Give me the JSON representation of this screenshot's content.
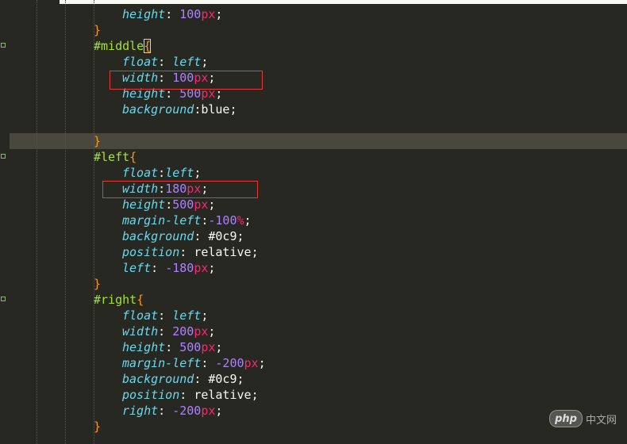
{
  "editor": {
    "theme_colors": {
      "background": "#272822",
      "property": "#66d9ef",
      "number": "#ae81ff",
      "unit": "#f92672",
      "selector": "#a6e22e",
      "brace": "#fd971f",
      "highlight_box": "#e03c3c"
    },
    "lines": [
      {
        "prop": "height",
        "colon": ": ",
        "num": "100",
        "unit": "px",
        "end": ";"
      },
      {
        "brace": "}"
      },
      {
        "selector": "#middle",
        "open": "{"
      },
      {
        "prop": "float",
        "colon": ": ",
        "kw": "left",
        "end": ";"
      },
      {
        "prop": "width",
        "colon": ": ",
        "num": "100",
        "unit": "px",
        "end": ";"
      },
      {
        "prop": "height",
        "colon": ": ",
        "num": "500",
        "unit": "px",
        "end": ";"
      },
      {
        "prop": "background",
        "colon": ":",
        "val": "blue",
        "end": ";"
      },
      {},
      {
        "brace": "}"
      },
      {
        "selector": "#left",
        "open": "{"
      },
      {
        "prop": "float",
        "colon": ":",
        "kw": "left",
        "end": ";"
      },
      {
        "prop": "width",
        "colon": ":",
        "num": "180",
        "unit": "px",
        "end": ";"
      },
      {
        "prop": "height",
        "colon": ":",
        "num": "500",
        "unit": "px",
        "end": ";"
      },
      {
        "prop": "margin-left",
        "colon": ":",
        "num": "-100",
        "unit": "%",
        "end": ";"
      },
      {
        "prop": "background",
        "colon": ": ",
        "val": "#0c9",
        "end": ";"
      },
      {
        "prop": "position",
        "colon": ": ",
        "val": "relative",
        "end": ";"
      },
      {
        "prop": "left",
        "colon": ": ",
        "num": "-180",
        "unit": "px",
        "end": ";"
      },
      {
        "brace": "}"
      },
      {
        "selector": "#right",
        "open": "{"
      },
      {
        "prop": "float",
        "colon": ": ",
        "kw": "left",
        "end": ";"
      },
      {
        "prop": "width",
        "colon": ": ",
        "num": "200",
        "unit": "px",
        "end": ";"
      },
      {
        "prop": "height",
        "colon": ": ",
        "num": "500",
        "unit": "px",
        "end": ";"
      },
      {
        "prop": "margin-left",
        "colon": ": ",
        "num": "-200",
        "unit": "px",
        "end": ";"
      },
      {
        "prop": "background",
        "colon": ": ",
        "val": "#0c9",
        "end": ";"
      },
      {
        "prop": "position",
        "colon": ": ",
        "val": "relative",
        "end": ";"
      },
      {
        "prop": "right",
        "colon": ": ",
        "num": "-200",
        "unit": "px",
        "end": ";"
      },
      {
        "brace": "}"
      }
    ]
  },
  "watermark": {
    "logo_text": "php",
    "site_text": "中文网"
  }
}
